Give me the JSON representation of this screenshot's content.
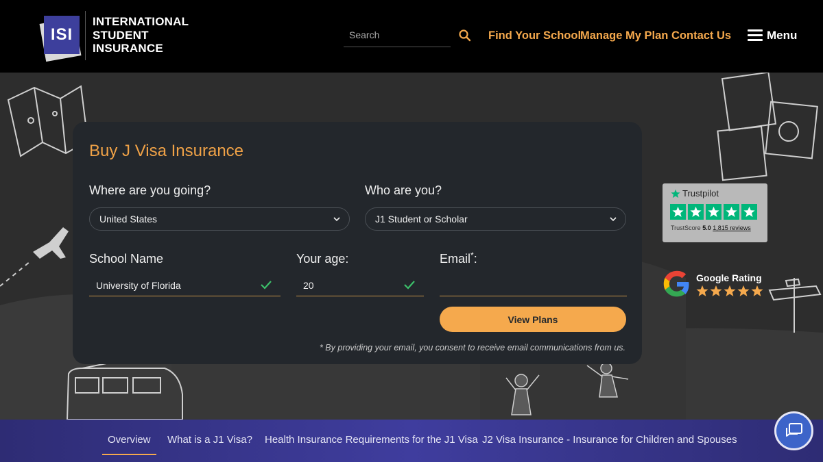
{
  "header": {
    "logo_mark": "ISI",
    "logo_lines": [
      "INTERNATIONAL",
      "STUDENT",
      "INSURANCE"
    ],
    "search_placeholder": "Search",
    "nav": [
      "Find Your School",
      "Manage My Plan",
      "Contact Us"
    ],
    "menu_label": "Menu"
  },
  "form": {
    "title": "Buy J Visa Insurance",
    "destination_label": "Where are you going?",
    "destination_value": "United States",
    "who_label": "Who are you?",
    "who_value": "J1 Student or Scholar",
    "school_label": "School Name",
    "school_value": "University of Florida",
    "age_label": "Your age:",
    "age_value": "20",
    "email_label": "Email",
    "email_required": "*",
    "email_suffix": ":",
    "email_value": "",
    "submit_label": "View Plans",
    "consent": "* By providing your email, you consent to receive email communications from us."
  },
  "trustpilot": {
    "brand": "Trustpilot",
    "score_label": "TrustScore",
    "score": "5.0",
    "reviews": "1,815 reviews",
    "star_count": 5
  },
  "google": {
    "label": "Google Rating",
    "star_count": 5
  },
  "subnav": {
    "items": [
      "Overview",
      "What is a J1 Visa?",
      "Health Insurance Requirements for the J1 Visa",
      "J2 Visa Insurance - Insurance for Children and Spouses"
    ],
    "active": 0
  },
  "colors": {
    "accent": "#f5a94d",
    "header_bg": "#000000",
    "card_bg": "#23272c",
    "subnav_bg": "#3f3d9e",
    "trustpilot_green": "#00b67a",
    "check_green": "#3cc06a"
  },
  "icons": {
    "search": "search-icon",
    "menu": "hamburger-icon",
    "dropdown": "chevron-down-icon",
    "valid": "check-icon",
    "chat": "chat-icon"
  }
}
